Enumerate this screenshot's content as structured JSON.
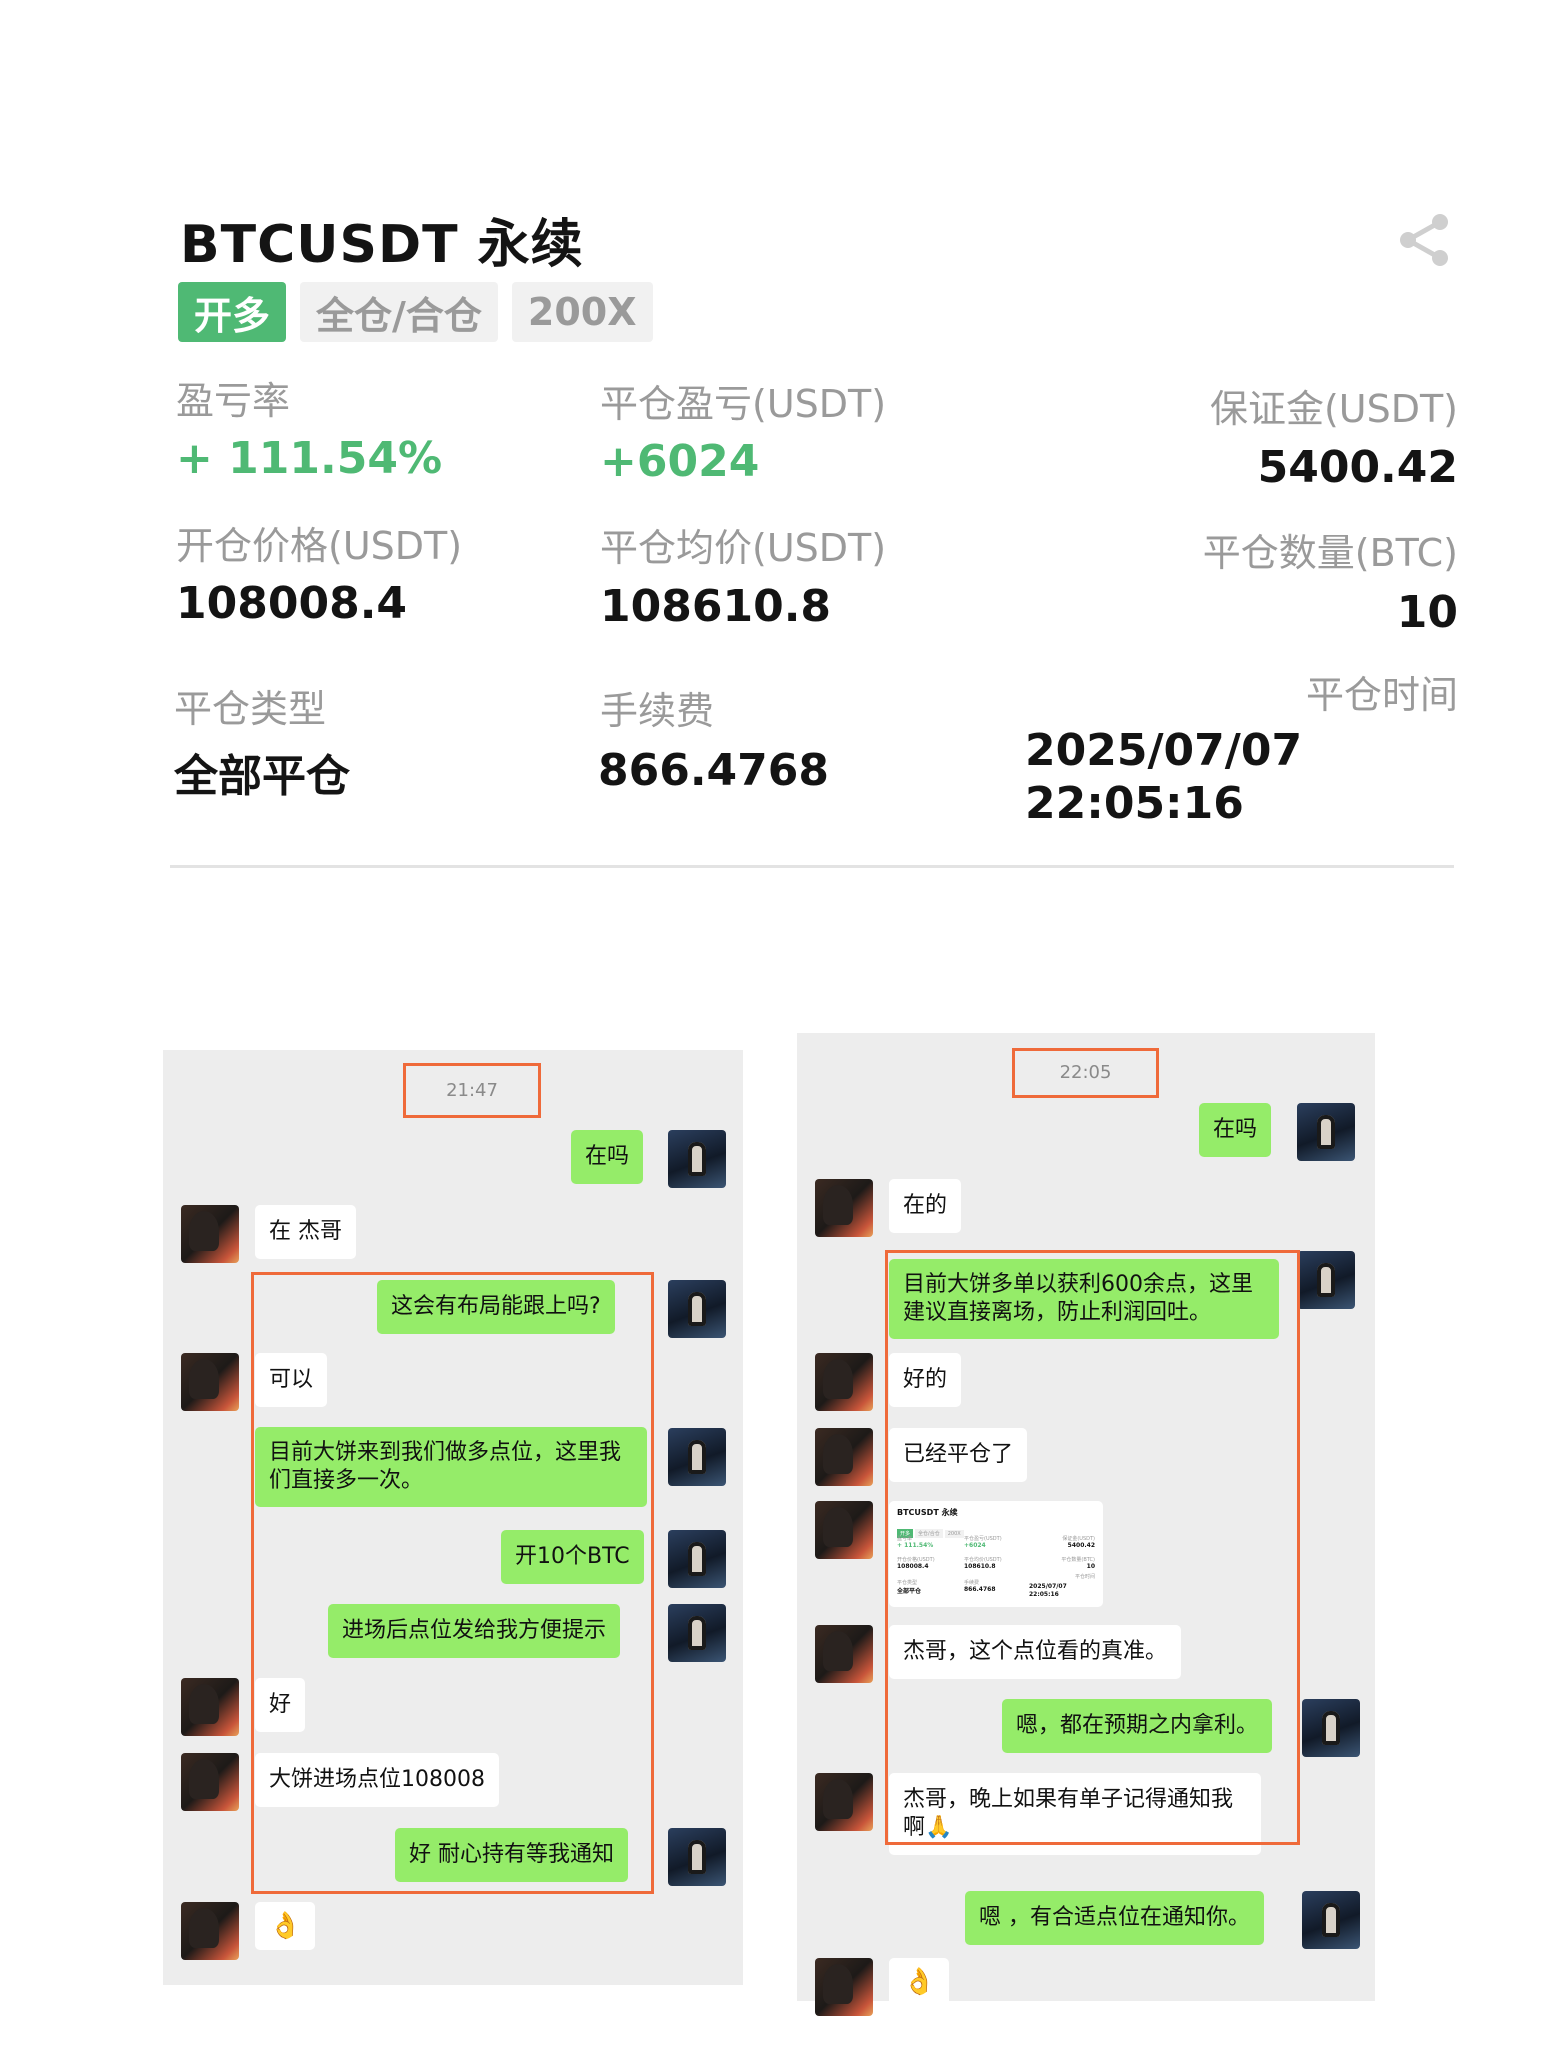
{
  "card": {
    "title": "BTCUSDT 永续",
    "tags": [
      "开多",
      "全仓/合仓",
      "200X"
    ],
    "pnl_rate_label": "盈亏率",
    "pnl_rate_value": "+ 111.54%",
    "close_pnl_label": "平仓盈亏(USDT)",
    "close_pnl_value": "+6024",
    "margin_label": "保证金(USDT)",
    "margin_value": "5400.42",
    "open_price_label": "开仓价格(USDT)",
    "open_price_value": "108008.4",
    "close_avg_label": "平仓均价(USDT)",
    "close_avg_value": "108610.8",
    "close_qty_label": "平仓数量(BTC)",
    "close_qty_value": "10",
    "close_type_label": "平仓类型",
    "close_type_value": "全部平仓",
    "fee_label": "手续费",
    "fee_value": "866.4768",
    "close_time_label": "平仓时间",
    "close_date": "2025/07/07",
    "close_clock": "22:05:16",
    "colors": {
      "green": "#4fb974",
      "highlight": "#ef6a3a",
      "bubble_green": "#95ec69"
    }
  },
  "chat_left": {
    "time": "21:47",
    "messages": [
      {
        "from": "me",
        "text": "在吗"
      },
      {
        "from": "other",
        "text": "在 杰哥"
      },
      {
        "from": "me",
        "text": "这会有布局能跟上吗?"
      },
      {
        "from": "other",
        "text": "可以"
      },
      {
        "from": "other",
        "text": "目前大饼来到我们做多点位，这里我们直接多一次。"
      },
      {
        "from": "me",
        "text": "开10个BTC"
      },
      {
        "from": "me",
        "text": "进场后点位发给我方便提示"
      },
      {
        "from": "other",
        "text": "好"
      },
      {
        "from": "other",
        "text": "大饼进场点位108008"
      },
      {
        "from": "me",
        "text": "好 耐心持有等我通知"
      },
      {
        "from": "other",
        "text": "👌"
      }
    ]
  },
  "chat_right": {
    "time": "22:05",
    "messages": [
      {
        "from": "me",
        "text": "在吗"
      },
      {
        "from": "other",
        "text": "在的"
      },
      {
        "from": "other",
        "text": "目前大饼多单以获利600余点，这里建议直接离场，防止利润回吐。"
      },
      {
        "from": "other",
        "text": "好的"
      },
      {
        "from": "other",
        "text": "已经平仓了"
      },
      {
        "from": "other",
        "text": "杰哥，这个点位看的真准。"
      },
      {
        "from": "me",
        "text": "嗯，都在预期之内拿利。"
      },
      {
        "from": "other",
        "text": "杰哥，晚上如果有单子记得通知我啊🙏"
      },
      {
        "from": "me",
        "text": "嗯 ，有合适点位在通知你。"
      },
      {
        "from": "other",
        "text": "👌"
      }
    ]
  },
  "icons": {
    "share": "share-icon",
    "avatar_me": "avatar-icon",
    "avatar_other": "avatar-icon"
  }
}
